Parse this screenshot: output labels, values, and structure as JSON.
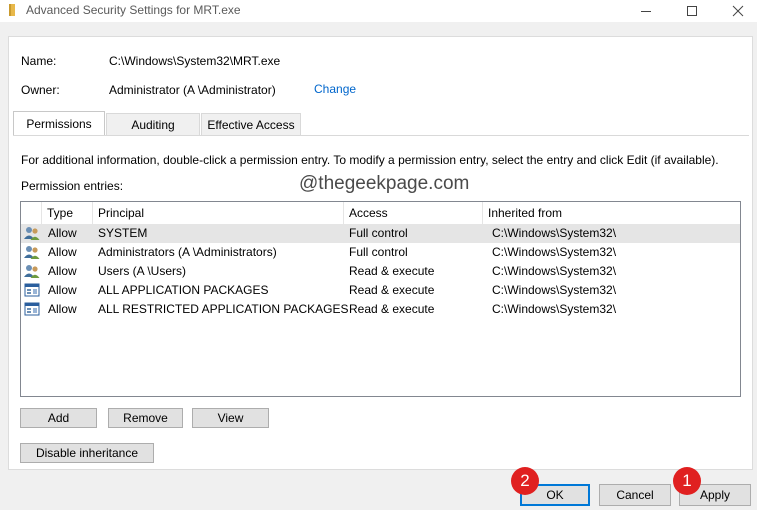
{
  "window": {
    "title": "Advanced Security Settings for MRT.exe"
  },
  "object": {
    "name_label": "Name:",
    "name_value": "C:\\Windows\\System32\\MRT.exe",
    "owner_label": "Owner:",
    "owner_value": "Administrator (A        \\Administrator)",
    "change_link": "Change"
  },
  "tabs": [
    {
      "label": "Permissions",
      "active": true
    },
    {
      "label": "Auditing",
      "active": false
    },
    {
      "label": "Effective Access",
      "active": false
    }
  ],
  "info_text": "For additional information, double-click a permission entry. To modify a permission entry, select the entry and click Edit (if available).",
  "entries_label": "Permission entries:",
  "watermark": "@thegeekpage.com",
  "columns": [
    "Type",
    "Principal",
    "Access",
    "Inherited from"
  ],
  "rows": [
    {
      "icon": "users-icon",
      "type": "Allow",
      "principal": "SYSTEM",
      "access": "Full control",
      "inherited": "C:\\Windows\\System32\\",
      "selected": true
    },
    {
      "icon": "users-icon",
      "type": "Allow",
      "principal": "Administrators (A        \\Administrators)",
      "access": "Full control",
      "inherited": "C:\\Windows\\System32\\",
      "selected": false
    },
    {
      "icon": "users-icon",
      "type": "Allow",
      "principal": "Users (A        \\Users)",
      "access": "Read & execute",
      "inherited": "C:\\Windows\\System32\\",
      "selected": false
    },
    {
      "icon": "app-package-icon",
      "type": "Allow",
      "principal": "ALL APPLICATION PACKAGES",
      "access": "Read & execute",
      "inherited": "C:\\Windows\\System32\\",
      "selected": false
    },
    {
      "icon": "app-package-icon",
      "type": "Allow",
      "principal": "ALL RESTRICTED APPLICATION PACKAGES",
      "access": "Read & execute",
      "inherited": "C:\\Windows\\System32\\",
      "selected": false
    }
  ],
  "buttons": {
    "add": "Add",
    "remove": "Remove",
    "view": "View",
    "disable_inheritance": "Disable inheritance",
    "ok": "OK",
    "cancel": "Cancel",
    "apply": "Apply"
  },
  "badges": {
    "ok_step": "2",
    "apply_step": "1"
  },
  "colors": {
    "link": "#0066cc",
    "focus_border": "#0078d7",
    "badge": "#e02020",
    "selected_row": "#e5e5e5"
  }
}
